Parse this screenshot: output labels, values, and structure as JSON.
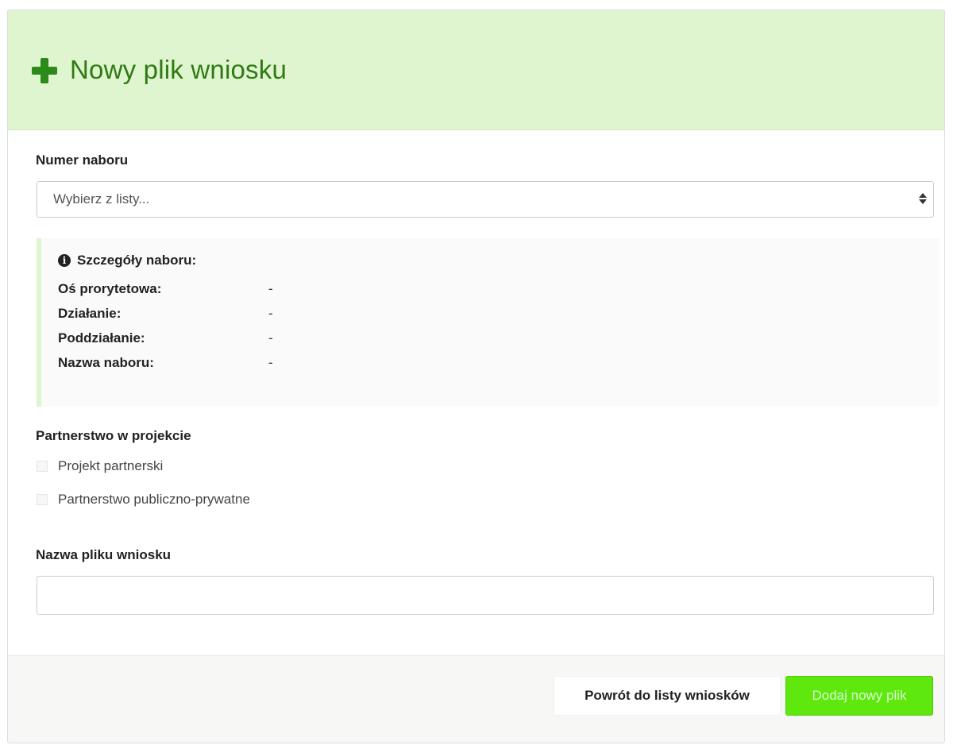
{
  "header": {
    "title": "Nowy plik wniosku",
    "icon": "plus-icon",
    "icon_color": "#2c8a1b",
    "background_color": "#dff5cf"
  },
  "form": {
    "numer_naboru": {
      "label": "Numer naboru",
      "selected": "Wybierz z listy..."
    },
    "details": {
      "title": "Szczegóły naboru:",
      "icon": "info-icon",
      "rows": [
        {
          "key": "Oś prorytetowa:",
          "value": "-"
        },
        {
          "key": "Działanie:",
          "value": "-"
        },
        {
          "key": "Poddziałanie:",
          "value": "-"
        },
        {
          "key": "Nazwa naboru:",
          "value": "-"
        }
      ]
    },
    "partnerstwo": {
      "label": "Partnerstwo w projekcie",
      "options": [
        {
          "label": "Projekt partnerski",
          "checked": false
        },
        {
          "label": "Partnerstwo publiczno-prywatne",
          "checked": false
        }
      ]
    },
    "nazwa_pliku": {
      "label": "Nazwa pliku wniosku",
      "value": ""
    }
  },
  "footer": {
    "back_label": "Powrót do listy wniosków",
    "add_label": "Dodaj nowy plik",
    "add_color": "#5ee80e"
  }
}
